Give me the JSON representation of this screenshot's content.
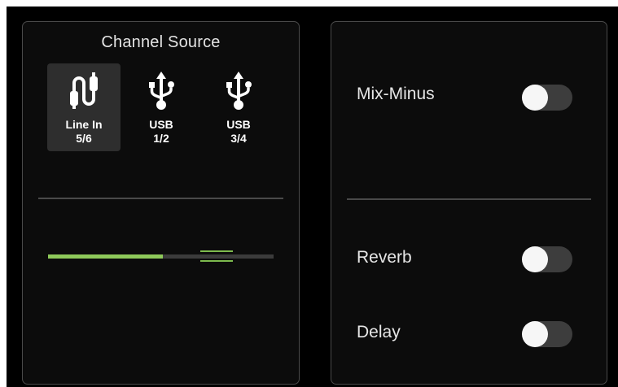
{
  "channel_source": {
    "title": "Channel Source",
    "sources": [
      {
        "line1": "Line In",
        "line2": "5/6",
        "icon": "line-in-cable-icon",
        "selected": true
      },
      {
        "line1": "USB",
        "line2": "1/2",
        "icon": "usb-icon",
        "selected": false
      },
      {
        "line1": "USB",
        "line2": "3/4",
        "icon": "usb-icon",
        "selected": false
      }
    ],
    "meter": {
      "level": 0.51
    }
  },
  "effects": {
    "mix_minus": {
      "label": "Mix-Minus",
      "on": false
    },
    "reverb": {
      "label": "Reverb",
      "on": false
    },
    "delay": {
      "label": "Delay",
      "on": false
    }
  },
  "colors": {
    "meter_fill": "#8ec95a",
    "selected_bg": "#2e2e2e",
    "toggle_off_track": "#3d3d3d"
  }
}
